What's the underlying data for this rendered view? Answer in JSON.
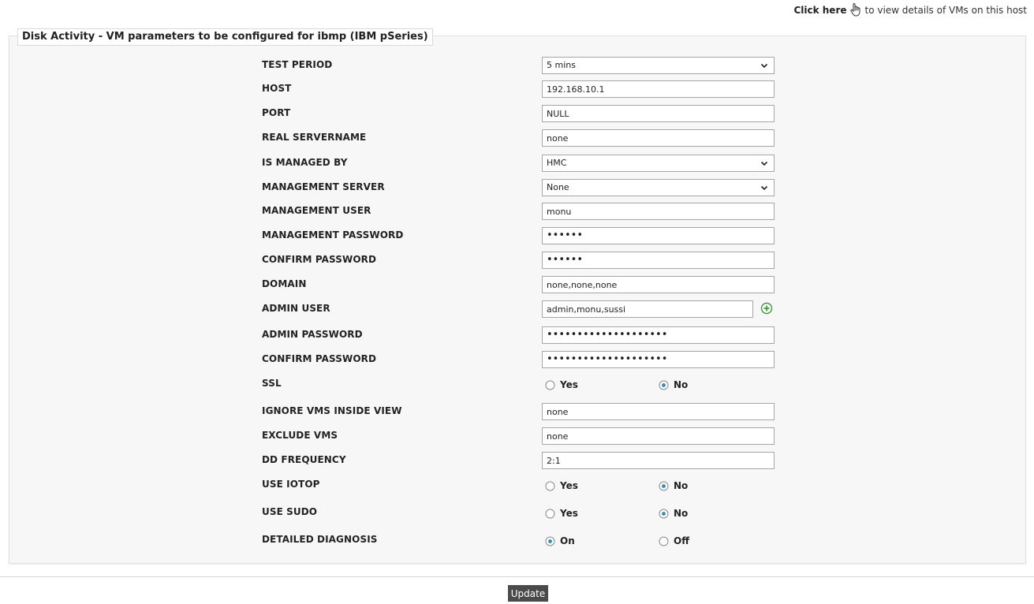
{
  "header": {
    "link_text": "Click here",
    "note_text": "to view details of VMs on this host"
  },
  "panel": {
    "title": "Disk Activity - VM parameters to be configured for ibmp (IBM pSeries)"
  },
  "fields": {
    "test_period": {
      "label": "TEST PERIOD",
      "value": "5 mins"
    },
    "host": {
      "label": "HOST",
      "value": "192.168.10.1"
    },
    "port": {
      "label": "PORT",
      "value": "NULL"
    },
    "real_servername": {
      "label": "REAL SERVERNAME",
      "value": "none"
    },
    "is_managed_by": {
      "label": "IS MANAGED BY",
      "value": "HMC"
    },
    "management_server": {
      "label": "MANAGEMENT SERVER",
      "value": "None"
    },
    "management_user": {
      "label": "MANAGEMENT USER",
      "value": "monu"
    },
    "management_password": {
      "label": "MANAGEMENT PASSWORD",
      "value": "••••••"
    },
    "confirm_password_1": {
      "label": "CONFIRM PASSWORD",
      "value": "••••••"
    },
    "domain": {
      "label": "DOMAIN",
      "value": "none,none,none"
    },
    "admin_user": {
      "label": "ADMIN USER",
      "value": "admin,monu,sussi"
    },
    "admin_password": {
      "label": "ADMIN PASSWORD",
      "value": "••••••••••••••••••••"
    },
    "confirm_password_2": {
      "label": "CONFIRM PASSWORD",
      "value": "••••••••••••••••••••"
    },
    "ssl": {
      "label": "SSL",
      "option1": "Yes",
      "option2": "No",
      "selected": "No"
    },
    "ignore_vms_inside_view": {
      "label": "IGNORE VMS INSIDE VIEW",
      "value": "none"
    },
    "exclude_vms": {
      "label": "EXCLUDE VMS",
      "value": "none"
    },
    "dd_frequency": {
      "label": "DD FREQUENCY",
      "value": "2:1"
    },
    "use_iotop": {
      "label": "USE IOTOP",
      "option1": "Yes",
      "option2": "No",
      "selected": "No"
    },
    "use_sudo": {
      "label": "USE SUDO",
      "option1": "Yes",
      "option2": "No",
      "selected": "No"
    },
    "detailed_diagnosis": {
      "label": "DETAILED DIAGNOSIS",
      "option1": "On",
      "option2": "Off",
      "selected": "On"
    }
  },
  "footer": {
    "update_label": "Update"
  },
  "colors": {
    "radio_accent": "#2b8fb8",
    "add_icon": "#3c9a3c",
    "button_bg": "#4a4a4a"
  },
  "icons": {
    "hand": "hand-pointer-icon",
    "add": "plus-circle-icon",
    "chevron": "chevron-down-icon"
  }
}
